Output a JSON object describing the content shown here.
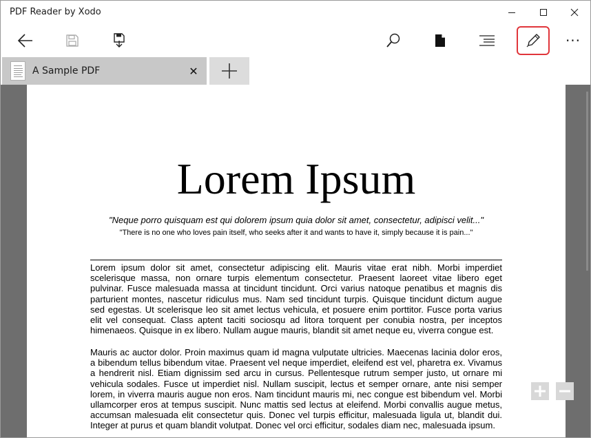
{
  "window": {
    "title": "PDF Reader by Xodo",
    "controls": [
      "minimize-icon",
      "maximize-icon",
      "close-icon"
    ]
  },
  "toolbar": {
    "left_buttons": [
      "back-arrow-icon",
      "save-icon",
      "save-as-icon"
    ],
    "right_buttons": [
      "search-icon",
      "page-icon",
      "outline-icon",
      "pencil-icon",
      "more-icon"
    ],
    "more_glyph": "···",
    "accent_color": "#e0353a"
  },
  "tabs": {
    "items": [
      {
        "label": "A Sample PDF"
      }
    ],
    "close_glyph": "✕",
    "add_glyph": "+"
  },
  "document": {
    "title": "Lorem Ipsum",
    "quote_latin": "\"Neque porro quisquam est qui dolorem ipsum quia dolor sit amet, consectetur, adipisci velit...\"",
    "quote_english": "\"There is no one who loves pain itself, who seeks after it and wants to have it, simply because it is pain...\"",
    "paragraphs": [
      "Lorem ipsum dolor sit amet, consectetur adipiscing elit. Mauris vitae erat nibh. Morbi imperdiet scelerisque massa, non ornare turpis elementum consectetur. Praesent laoreet vitae libero eget pulvinar. Fusce malesuada massa at tincidunt tincidunt. Orci varius natoque penatibus et magnis dis parturient montes, nascetur ridiculus mus. Nam sed tincidunt turpis. Quisque tincidunt dictum augue sed egestas. Ut scelerisque leo sit amet lectus vehicula, et posuere enim porttitor. Fusce porta varius elit vel consequat. Class aptent taciti sociosqu ad litora torquent per conubia nostra, per inceptos himenaeos. Quisque in ex libero. Nullam augue mauris, blandit sit amet neque eu, viverra congue est.",
      "Mauris ac auctor dolor. Proin maximus quam id magna vulputate ultricies. Maecenas lacinia dolor eros, a bibendum tellus bibendum vitae. Praesent vel neque imperdiet, eleifend est vel, pharetra ex. Vivamus a hendrerit nisl. Etiam dignissim sed arcu in cursus. Pellentesque rutrum semper justo, ut ornare mi vehicula sodales. Fusce ut imperdiet nisl. Nullam suscipit, lectus et semper ornare, ante nisi semper lorem, in viverra mauris augue non eros. Nam tincidunt mauris mi, nec congue est bibendum vel. Morbi ullamcorper eros at tempus suscipit. Nunc mattis sed lectus at eleifend. Morbi convallis augue metus, accumsan malesuada elit consectetur quis. Donec vel turpis efficitur, malesuada ligula ut, blandit dui. Integer at purus et quam blandit volutpat. Donec vel orci efficitur, sodales diam nec, malesuada ipsum."
    ]
  },
  "zoom": {
    "in_glyph": "+",
    "out_glyph": "−"
  }
}
